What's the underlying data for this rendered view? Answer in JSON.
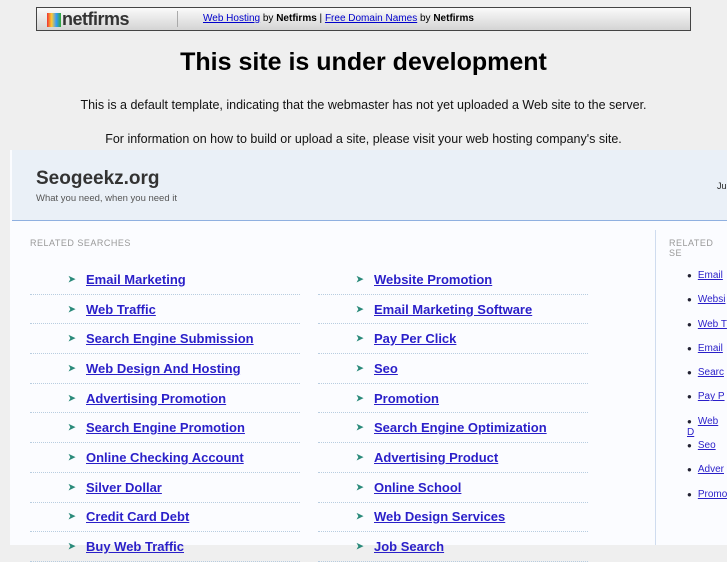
{
  "banner": {
    "logo": "netfirms",
    "link1": "Web Hosting",
    "by1": " by ",
    "brand1": "Netfirms",
    "pipe": " | ",
    "link2": "Free Domain Names",
    "by2": " by ",
    "brand2": "Netfirms"
  },
  "title": "This site is under development",
  "line1": "This is a default template, indicating that the webmaster has not yet uploaded a Web site to the server.",
  "line2": "For information on how to build or upload a site, please visit your web hosting company's site.",
  "park": {
    "site": "Seogeekz.org",
    "tagline": "What you need, when you need it",
    "right_fragment": "Ju",
    "related_label": "RELATED SEARCHES",
    "side_label": "RELATED SE",
    "left_col": [
      "Email Marketing",
      "Web Traffic",
      "Search Engine Submission",
      "Web Design And Hosting",
      "Advertising Promotion",
      "Search Engine Promotion",
      "Online Checking Account",
      "Silver Dollar",
      "Credit Card Debt",
      "Buy Web Traffic"
    ],
    "right_col": [
      "Website Promotion",
      "Email Marketing Software",
      "Pay Per Click",
      "Seo",
      "Promotion",
      "Search Engine Optimization",
      "Advertising Product",
      "Online School",
      "Web Design Services",
      "Job Search"
    ],
    "side": [
      "Email",
      "Websi",
      "Web T",
      "Email",
      "Searc",
      "Pay P",
      "Web D",
      "Seo",
      "Adver",
      "Promo"
    ]
  }
}
